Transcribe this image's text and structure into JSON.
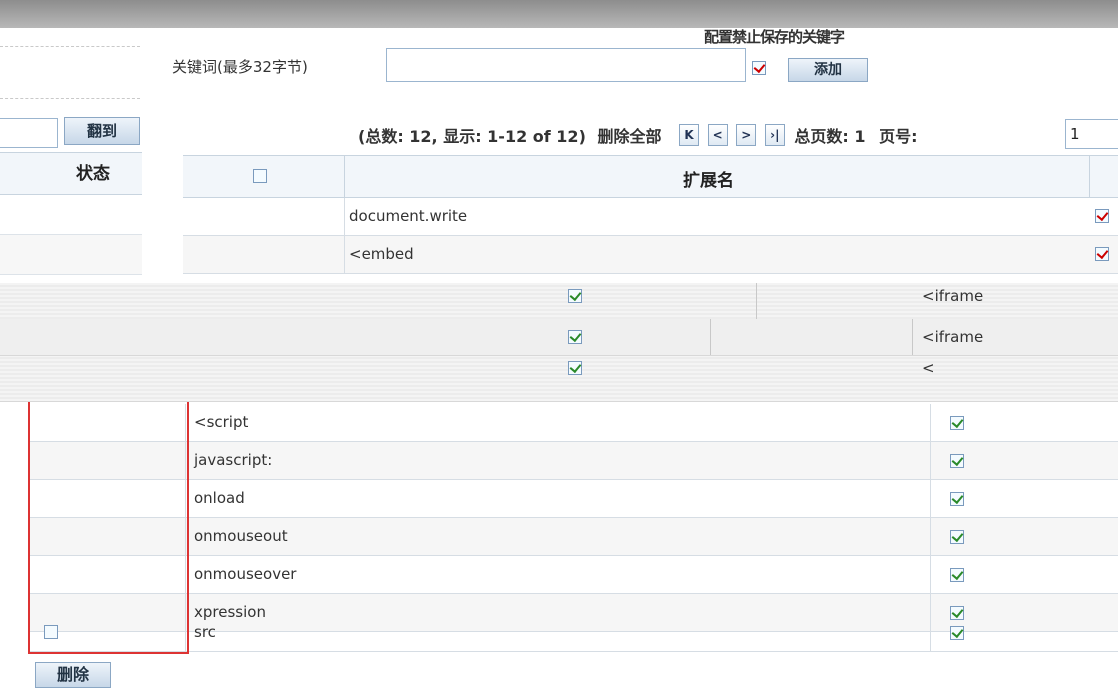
{
  "window": {
    "title": "配置禁止保存的关键字"
  },
  "keyword_form": {
    "label": "关键词(最多32字节)",
    "input_value": "",
    "checkbox_checked": true,
    "add_button": "添加"
  },
  "left_panel": {
    "page_input_value": "",
    "goto_button": "翻到",
    "status_header": "状态"
  },
  "pager": {
    "summary": "(总数: 12, 显示: 1-12 of 12)",
    "delete_all": "删除全部",
    "first_icon": "K",
    "prev_icon": "<",
    "next_icon": ">",
    "last_icon": "›|",
    "total_pages_label": "总页数: 1",
    "page_label": "页号:",
    "page_value": "1"
  },
  "table": {
    "header_ext": "扩展名",
    "rows_top": [
      {
        "name": "document.write",
        "flag_checked": true
      },
      {
        "name": "<embed",
        "flag_checked": true
      }
    ],
    "overlay_rows": [
      {
        "name": "<iframe",
        "flag_checked": true
      },
      {
        "name": "<iframe",
        "flag_checked": true
      },
      {
        "name": "<",
        "flag_checked": true
      }
    ],
    "rows_bottom": [
      {
        "name": "<script",
        "flag_checked": true,
        "select_checked": false
      },
      {
        "name": "javascript:",
        "flag_checked": true,
        "select_checked": false
      },
      {
        "name": "onload",
        "flag_checked": true,
        "select_checked": false
      },
      {
        "name": "onmouseout",
        "flag_checked": true,
        "select_checked": false
      },
      {
        "name": "onmouseover",
        "flag_checked": true,
        "select_checked": false
      },
      {
        "name": "xpression",
        "flag_checked": true,
        "select_checked": false
      },
      {
        "name": "src",
        "flag_checked": true,
        "select_checked": false,
        "show_select_box": true
      }
    ]
  },
  "footer": {
    "delete_button": "删除"
  },
  "colors": {
    "accent_border": "#8ba7c4",
    "check_green": "#2a8a2a",
    "check_red": "#cc0000",
    "highlight_red": "#dd3333"
  }
}
